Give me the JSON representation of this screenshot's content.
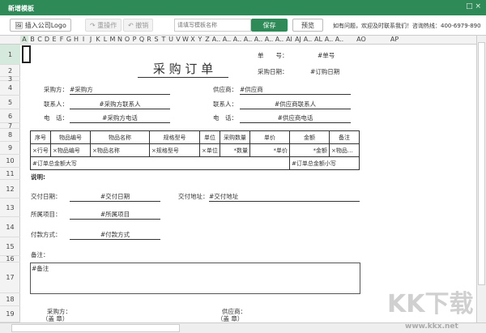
{
  "window": {
    "title": "新增模板",
    "controls": "□ ×"
  },
  "toolbar": {
    "insert_logo": "插入公司Logo",
    "redo": "↷ 重操作",
    "undo": "↶ 撤销",
    "name_placeholder": "请填写模板名称",
    "save": "保存",
    "preview": "预览",
    "help": "如有问题，欢迎及时联系我们！咨询热线：400-6979-890"
  },
  "columns": [
    "A",
    "B",
    "C",
    "D",
    "E",
    "F",
    "G",
    "H",
    "I",
    "J",
    "K",
    "L",
    "M",
    "N",
    "O",
    "P",
    "Q",
    "R",
    "S",
    "T",
    "U",
    "V",
    "W",
    "X",
    "Y",
    "Z",
    "A..",
    "A..",
    "A..",
    "A..",
    "A..",
    "A..",
    "A..",
    "AI",
    "AJ",
    "A..",
    "AL",
    "A..",
    "A..",
    "AO",
    "AP"
  ],
  "rows": [
    "1",
    "2",
    "3",
    "4",
    "5",
    "6",
    "7",
    "8",
    "9",
    "10",
    "11",
    "12",
    "13",
    "14",
    "15",
    "16",
    "17",
    "18",
    "19"
  ],
  "doc": {
    "title": "采 购 订 单",
    "order_no_label": "单　　号：",
    "order_no": "#单号",
    "date_label": "采购日期：",
    "date": "#订购日期",
    "buyer_label": "采购方：",
    "buyer": "#采购方",
    "buyer_contact_label": "联系人：",
    "buyer_contact": "#采购方联系人",
    "buyer_phone_label": "电　话：",
    "buyer_phone": "#采购方电话",
    "supplier_label": "供应商：",
    "supplier": "#供应商",
    "supplier_contact_label": "联系人：",
    "supplier_contact": "#供应商联系人",
    "supplier_phone_label": "电　话：",
    "supplier_phone": "#供应商电话",
    "table": {
      "headers": [
        "序号",
        "物品编号",
        "物品名称",
        "规格型号",
        "单位",
        "采购数量",
        "单价",
        "金额",
        "备注"
      ],
      "row": [
        "×行号",
        "×物品编号",
        "×物品名称",
        "×规格型号",
        "×单位",
        "*数量",
        "*单价",
        "*金额",
        "×物品…"
      ],
      "total_upper": "#订单总金额大写",
      "total_lower": "#订单总金额小写"
    },
    "notes_heading": "说明:",
    "delivery_date_label": "交付日期：",
    "delivery_date": "#交付日期",
    "delivery_addr_label": "交付地址：",
    "delivery_addr": "#交付地址",
    "project_label": "所属项目：",
    "project": "#所属项目",
    "payment_label": "付款方式：",
    "payment": "#付款方式",
    "remark_label": "备注：",
    "remark": "#备注",
    "sign_buyer": "采购方：",
    "sign_buyer_seal": "（盖 章）",
    "sign_supplier": "供应商：",
    "sign_supplier_seal": "（盖 章）"
  },
  "watermark": {
    "logo": "KK下载",
    "url": "www.kkx.net"
  },
  "colors": {
    "accent": "#2e8b57"
  }
}
